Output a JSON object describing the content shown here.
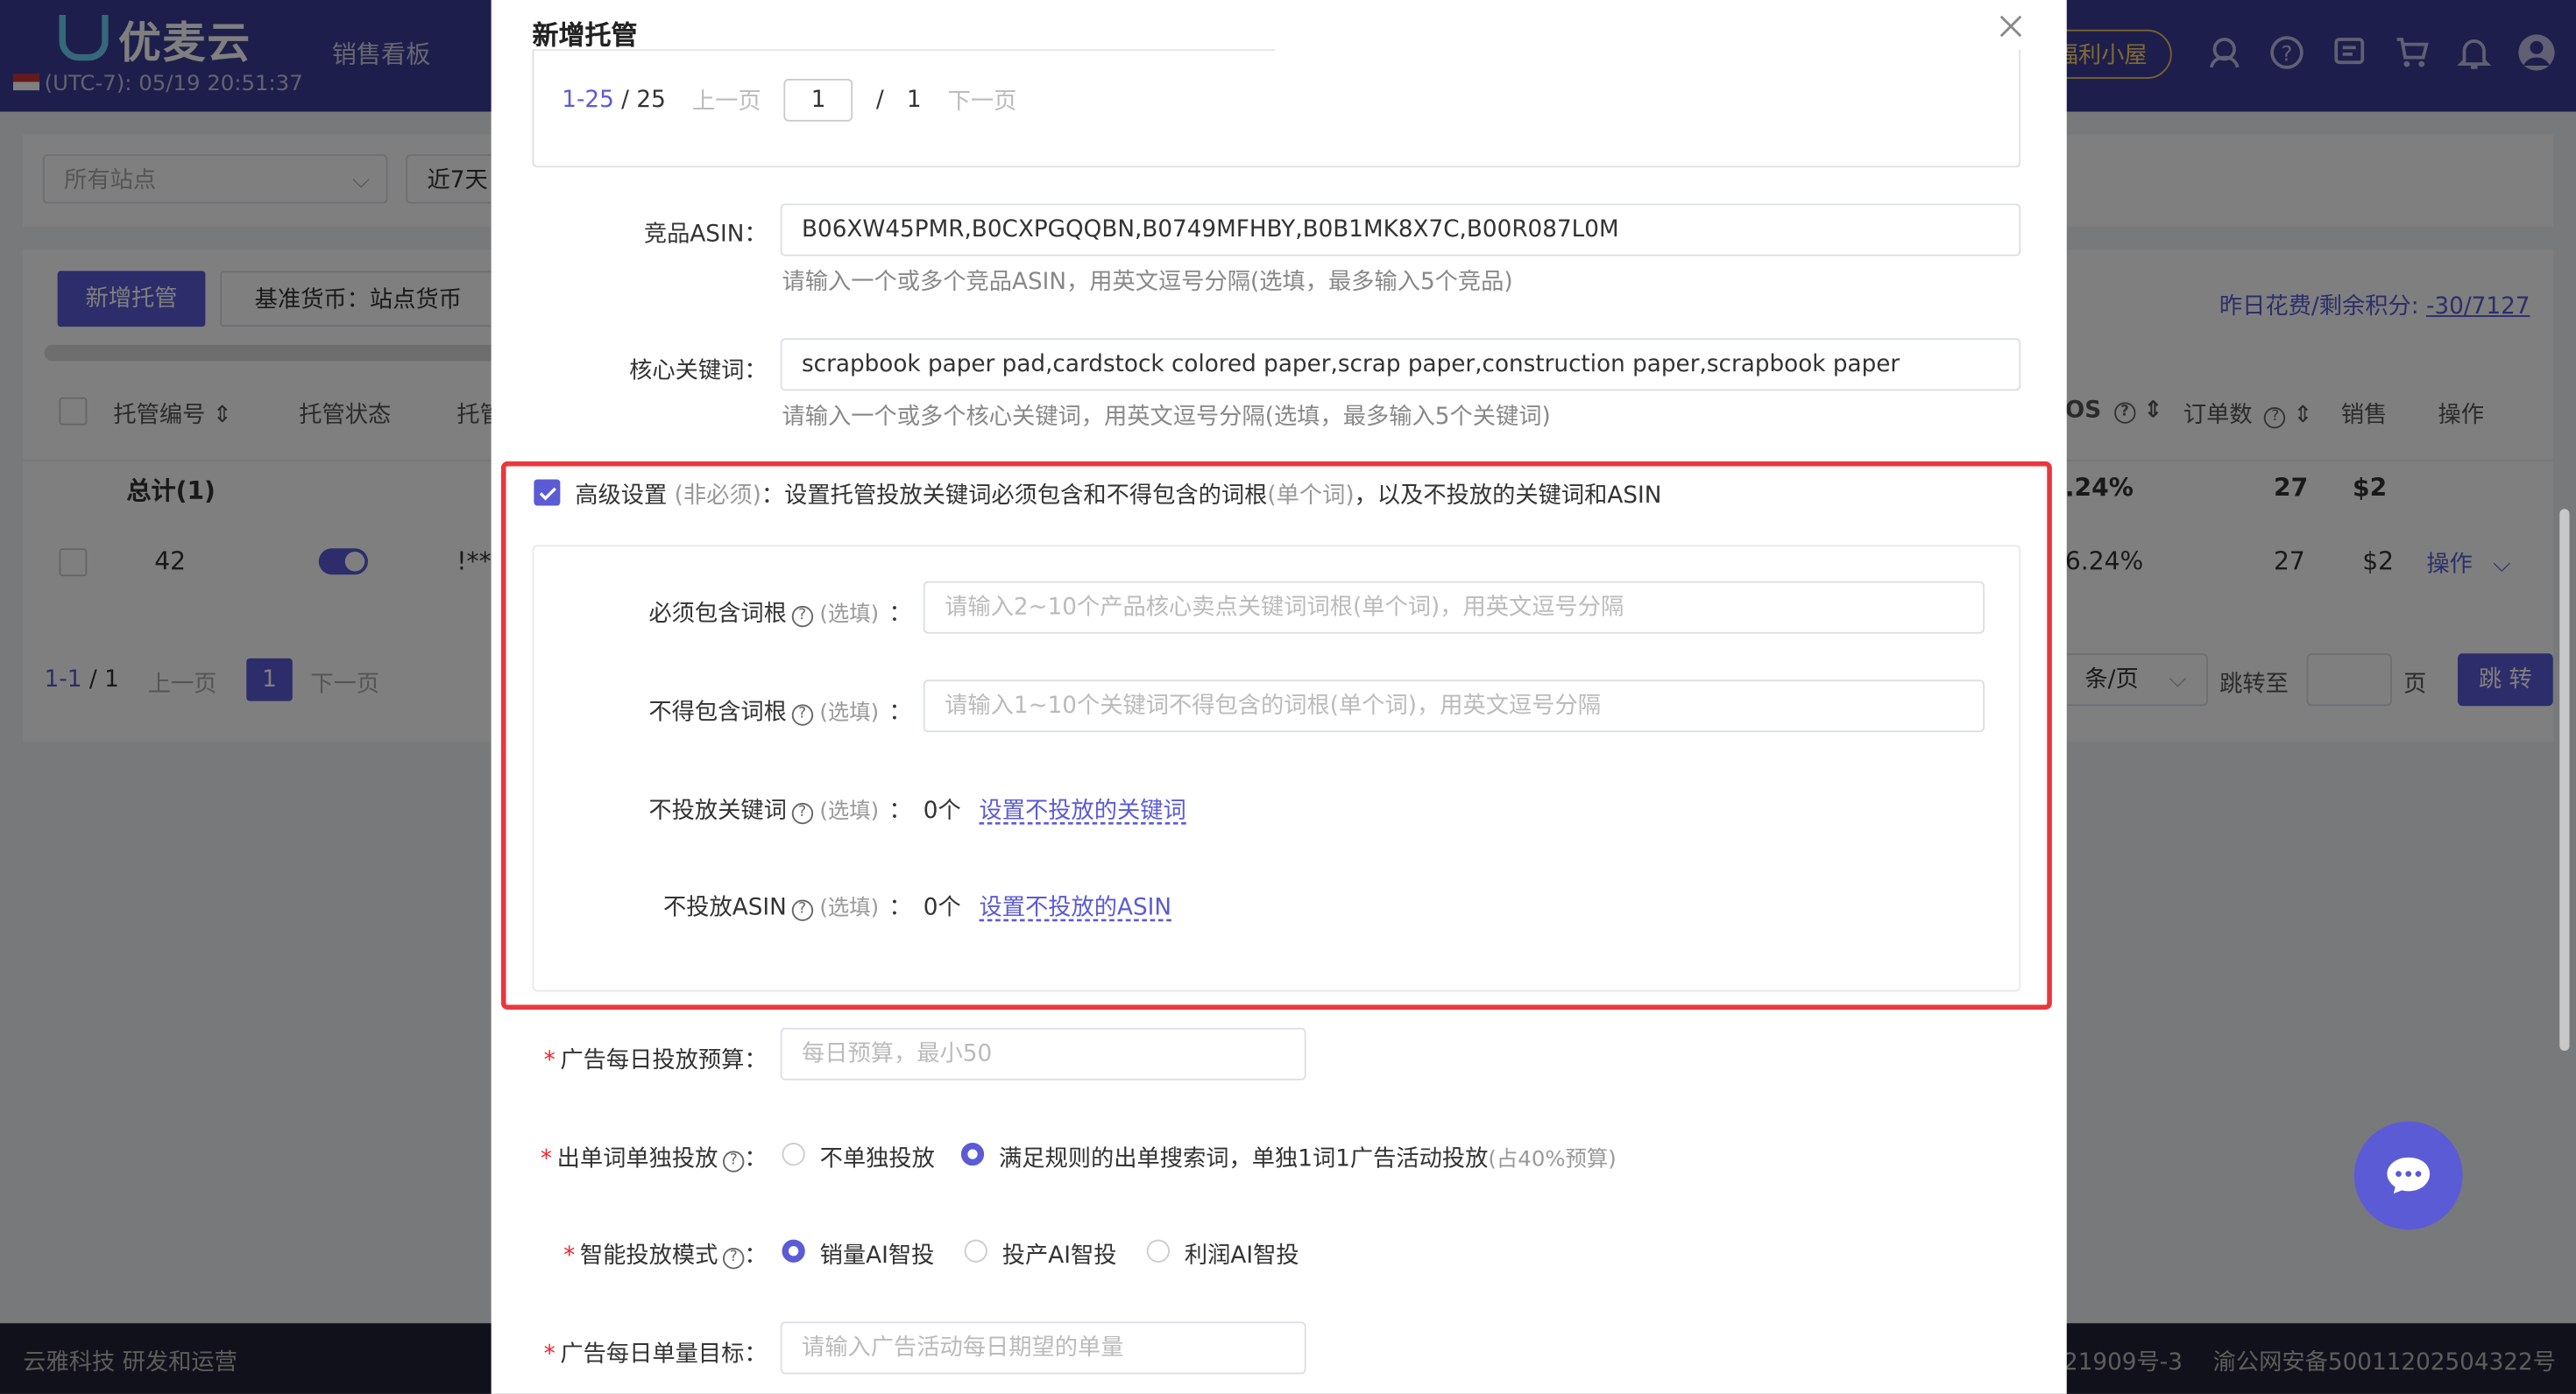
{
  "app": {
    "logo": "优麦云",
    "nav_sales": "销售看板",
    "timezone": "(UTC-7): 05/19 20:51:37",
    "welfare": "福利小屋"
  },
  "filters": {
    "site_placeholder": "所有站点",
    "days": "近7天"
  },
  "toolbar": {
    "new_button": "新增托管",
    "base_currency": "基准货币：站点货币",
    "spend_label": "昨日花费/剩余积分:",
    "spend_value": "-30/7127"
  },
  "table": {
    "headers": {
      "id": "托管编号",
      "status": "托管状态",
      "col3": "托管",
      "acos": "OS",
      "orders": "订单数",
      "sales": "销售",
      "actions": "操作"
    },
    "total_row": {
      "label": "总计(1)",
      "acos": ".24%",
      "orders": "27",
      "sales": "$2"
    },
    "rows": [
      {
        "id": "42",
        "name": "!**",
        "acos": "6.24%",
        "orders": "27",
        "sales": "$2",
        "action": "操作"
      }
    ]
  },
  "pagination": {
    "range": "1-1",
    "total": "1",
    "prev": "上一页",
    "current": "1",
    "next": "下一页",
    "per_page": "条/页",
    "jump_label": "跳转至",
    "page_unit": "页",
    "jump_button": "跳 转"
  },
  "footer": {
    "left": "云雅科技  研发和运营",
    "icp": "21909号-3",
    "police": "渝公网安备50011202504322号"
  },
  "dialog": {
    "title": "新增托管",
    "pager": {
      "range": "1-25",
      "total": "25",
      "prev": "上一页",
      "page_input": "1",
      "pages": "1",
      "next": "下一页"
    },
    "competitor_asin": {
      "label": "竞品ASIN：",
      "value": "B06XW45PMR,B0CXPGQQBN,B0749MFHBY,B0B1MK8X7C,B00R087L0M",
      "hint": "请输入一个或多个竞品ASIN，用英文逗号分隔(选填，最多输入5个竞品)"
    },
    "core_keywords": {
      "label": "核心关键词：",
      "value": "scrapbook paper pad,cardstock colored paper,scrap paper,construction paper,scrapbook paper",
      "hint": "请输入一个或多个核心关键词，用英文逗号分隔(选填，最多输入5个关键词)"
    },
    "advanced": {
      "title": "高级设置",
      "optional": "(非必须)",
      "desc1": "：设置托管投放关键词必须包含和不得包含的词根",
      "single": "(单个词)",
      "desc2": "，以及不投放的关键词和ASIN",
      "must_include": {
        "label": "必须包含词根",
        "optional": "(选填)",
        "colon": "：",
        "placeholder": "请输入2~10个产品核心卖点关键词词根(单个词)，用英文逗号分隔"
      },
      "must_exclude": {
        "label": "不得包含词根",
        "optional": "(选填)",
        "colon": "：",
        "placeholder": "请输入1~10个关键词不得包含的词根(单个词)，用英文逗号分隔"
      },
      "neg_keywords": {
        "label": "不投放关键词",
        "optional": "(选填)",
        "colon": "：",
        "count": "0个",
        "link": "设置不投放的关键词"
      },
      "neg_asin": {
        "label": "不投放ASIN",
        "optional": "(选填)",
        "colon": "：",
        "count": "0个",
        "link": "设置不投放的ASIN"
      }
    },
    "daily_budget": {
      "label": "广告每日投放预算：",
      "placeholder": "每日预算，最小50"
    },
    "single_keyword": {
      "label": "出单词单独投放",
      "colon": "：",
      "option1": "不单独投放",
      "option2": "满足规则的出单搜索词，单独1词1广告活动投放",
      "option2_note": "(占40%预算)"
    },
    "ai_mode": {
      "label": "智能投放模式",
      "colon": "：",
      "option1": "销量AI智投",
      "option2": "投产AI智投",
      "option3": "利润AI智投"
    },
    "daily_orders": {
      "label": "广告每日单量目标：",
      "placeholder": "请输入广告活动每日期望的单量"
    }
  },
  "colors": {
    "brand": "#5b5bd6",
    "topbar": "#3c3c98",
    "highlight": "#e8383d"
  }
}
